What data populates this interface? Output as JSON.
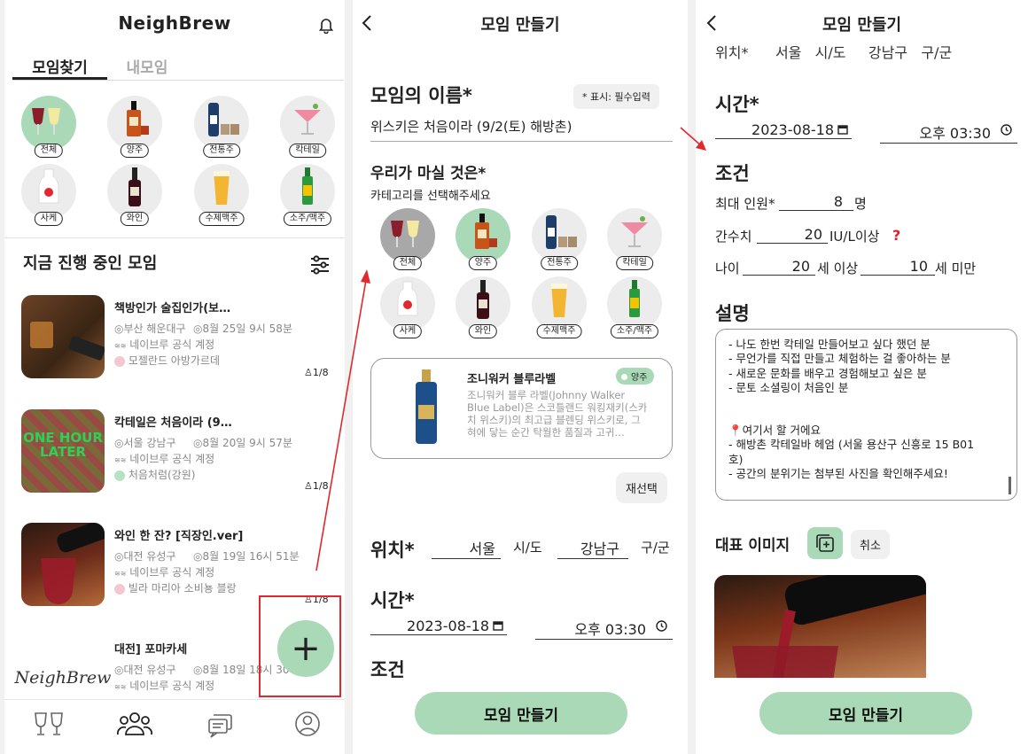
{
  "s1": {
    "app_title": "NeighBrew",
    "tabs": [
      "모임찾기",
      "내모임"
    ],
    "categories": [
      "전체",
      "양주",
      "전통주",
      "칵테일",
      "사케",
      "와인",
      "수제맥주",
      "소주/맥주"
    ],
    "section_title": "지금 진행 중인 모임",
    "meetings": [
      {
        "title": "책방인가 술집인가(보…",
        "location": "◎부산 해운대구",
        "datetime": "◎8월 25일 9시 58분",
        "host": "네이브루 공식 계정",
        "drink": "모젤란드 아방가르데",
        "count": "1/8"
      },
      {
        "title": "칵테일은 처음이라 (9…",
        "location": "◎서울 강남구",
        "datetime": "◎8월 20일 9시 57분",
        "host": "네이브루 공식 계정",
        "drink": "처음처럼(강원)",
        "count": "1/8"
      },
      {
        "title": "와인 한 잔? [직장인.ver]",
        "location": "◎대전 유성구",
        "datetime": "◎8월 19일 16시 51분",
        "host": "네이브루 공식 계정",
        "drink": "빌라 마리아 소비뇽 블랑",
        "count": "1/8"
      },
      {
        "title": "대전] 포마카세",
        "location": "◎대전 유성구",
        "datetime": "◎8월 18일 18시 30",
        "host": "네이브루 공식 계정",
        "drink": "",
        "count": ""
      }
    ],
    "thumb4_text": "NeighBrew",
    "thumb2_text": "ONE HOUR LATER",
    "fab_label": "+"
  },
  "s2": {
    "nav_title": "모임 만들기",
    "name_label": "모임의 이름*",
    "required_note": "* 표시: 필수입력",
    "name_value": "위스키은 처음이라 (9/2(토) 해방촌)",
    "drink_label": "우리가 마실 것은*",
    "drink_sub": "카테고리를 선택해주세요",
    "categories": [
      "전체",
      "양주",
      "전통주",
      "칵테일",
      "사케",
      "와인",
      "수제맥주",
      "소주/맥주"
    ],
    "product_name": "조니워커 블루라벨",
    "product_tag": "양주",
    "product_desc": "조니워커 블루 라벨(Johnny Walker Blue Label)은 스코틀랜드 워킹재키(스카치 위스키)의 최고급 블렌딩 위스키로, 그 혀에 닿는 순간 탁월한 품질과 고귀…",
    "reselect": "재선택",
    "location_label": "위치*",
    "city": "서울",
    "city_unit": "시/도",
    "district": "강남구",
    "district_unit": "구/군",
    "time_label": "시간*",
    "date": "2023-08-18",
    "time": "오후 03:30",
    "cond_label": "조건",
    "submit": "모임 만들기"
  },
  "s3": {
    "nav_title": "모임 만들기",
    "partial_top": "위치*      서울   시/도     강남구   구/군",
    "time_label": "시간*",
    "date": "2023-08-18",
    "time": "오후 03:30",
    "cond_label": "조건",
    "max_label": "최대 인원*",
    "max_value": "8",
    "max_unit": "명",
    "liver_label": "간수치",
    "liver_value": "20",
    "liver_unit": "IU/L이상",
    "age_label": "나이",
    "age_min": "20",
    "age_min_unit": "세 이상",
    "age_max": "10",
    "age_max_unit": "세 미만",
    "desc_label": "설명",
    "desc_lines": [
      "- 나도 한번 칵테일 만들어보고 싶다 했던 분",
      "- 무언가를 직접 만들고 체험하는 걸 좋아하는 분",
      "- 새로운 문화를 배우고 경험해보고 싶은 분",
      "- 문토 소셜링이 처음인 분",
      "",
      "",
      "📍여기서 할 거에요",
      "- 해방촌 칵테일바 헤엄 (서울 용산구 신흥로 15 B01",
      "호)",
      "- 공간의 분위기는 첨부된 사진을 확인해주세요!"
    ],
    "image_label": "대표 이미지",
    "cancel": "취소",
    "submit": "모임 만들기"
  },
  "colors": {
    "accent": "#a9d9b6",
    "annotation": "#e0282e"
  }
}
